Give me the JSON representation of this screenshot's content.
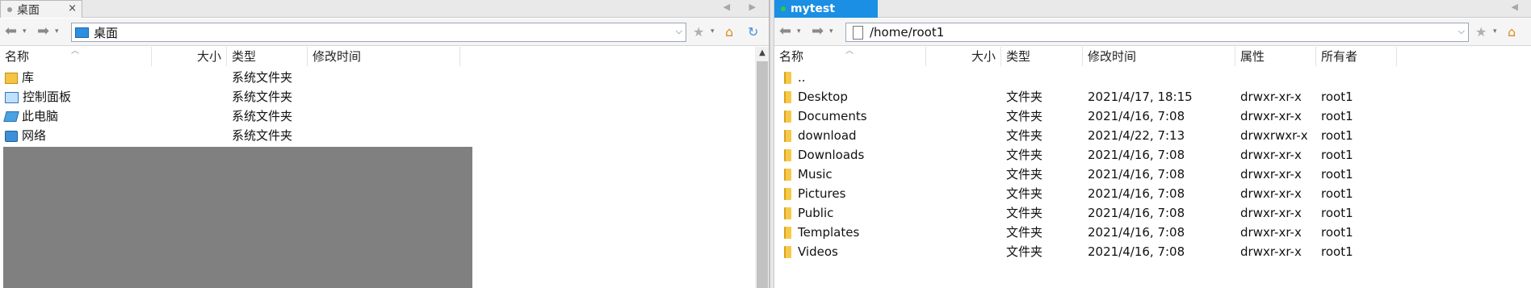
{
  "left": {
    "tab": {
      "label": "桌面",
      "close": "×",
      "dot_color": "#9a9a9a"
    },
    "address": {
      "path": "桌面",
      "icon": "desktop-icon"
    },
    "columns": [
      "名称",
      "大小",
      "类型",
      "修改时间"
    ],
    "rows": [
      {
        "name": "库",
        "size": "",
        "type": "系统文件夹",
        "mtime": "",
        "icon": "library-icon"
      },
      {
        "name": "控制面板",
        "size": "",
        "type": "系统文件夹",
        "mtime": "",
        "icon": "control-panel-icon"
      },
      {
        "name": "此电脑",
        "size": "",
        "type": "系统文件夹",
        "mtime": "",
        "icon": "computer-icon"
      },
      {
        "name": "网络",
        "size": "",
        "type": "系统文件夹",
        "mtime": "",
        "icon": "network-icon"
      }
    ]
  },
  "right": {
    "tab": {
      "label": "mytest",
      "dot_color": "#2ecc40",
      "bg": "#1a8fe3"
    },
    "address": {
      "path": "/home/root1",
      "icon": "file-icon"
    },
    "columns": [
      "名称",
      "大小",
      "类型",
      "修改时间",
      "属性",
      "所有者"
    ],
    "rows": [
      {
        "name": "..",
        "size": "",
        "type": "",
        "mtime": "",
        "attr": "",
        "owner": ""
      },
      {
        "name": "Desktop",
        "size": "",
        "type": "文件夹",
        "mtime": "2021/4/17, 18:15",
        "attr": "drwxr-xr-x",
        "owner": "root1"
      },
      {
        "name": "Documents",
        "size": "",
        "type": "文件夹",
        "mtime": "2021/4/16, 7:08",
        "attr": "drwxr-xr-x",
        "owner": "root1"
      },
      {
        "name": "download",
        "size": "",
        "type": "文件夹",
        "mtime": "2021/4/22, 7:13",
        "attr": "drwxrwxr-x",
        "owner": "root1"
      },
      {
        "name": "Downloads",
        "size": "",
        "type": "文件夹",
        "mtime": "2021/4/16, 7:08",
        "attr": "drwxr-xr-x",
        "owner": "root1"
      },
      {
        "name": "Music",
        "size": "",
        "type": "文件夹",
        "mtime": "2021/4/16, 7:08",
        "attr": "drwxr-xr-x",
        "owner": "root1"
      },
      {
        "name": "Pictures",
        "size": "",
        "type": "文件夹",
        "mtime": "2021/4/16, 7:08",
        "attr": "drwxr-xr-x",
        "owner": "root1"
      },
      {
        "name": "Public",
        "size": "",
        "type": "文件夹",
        "mtime": "2021/4/16, 7:08",
        "attr": "drwxr-xr-x",
        "owner": "root1"
      },
      {
        "name": "Templates",
        "size": "",
        "type": "文件夹",
        "mtime": "2021/4/16, 7:08",
        "attr": "drwxr-xr-x",
        "owner": "root1"
      },
      {
        "name": "Videos",
        "size": "",
        "type": "文件夹",
        "mtime": "2021/4/16, 7:08",
        "attr": "drwxr-xr-x",
        "owner": "root1"
      }
    ]
  },
  "icons": {
    "back": "◀",
    "forward": "▶",
    "dropdown": "▾",
    "chevron": "⌵",
    "star": "★",
    "home": "⌂",
    "refresh": "↻",
    "sort_up": "︿"
  }
}
